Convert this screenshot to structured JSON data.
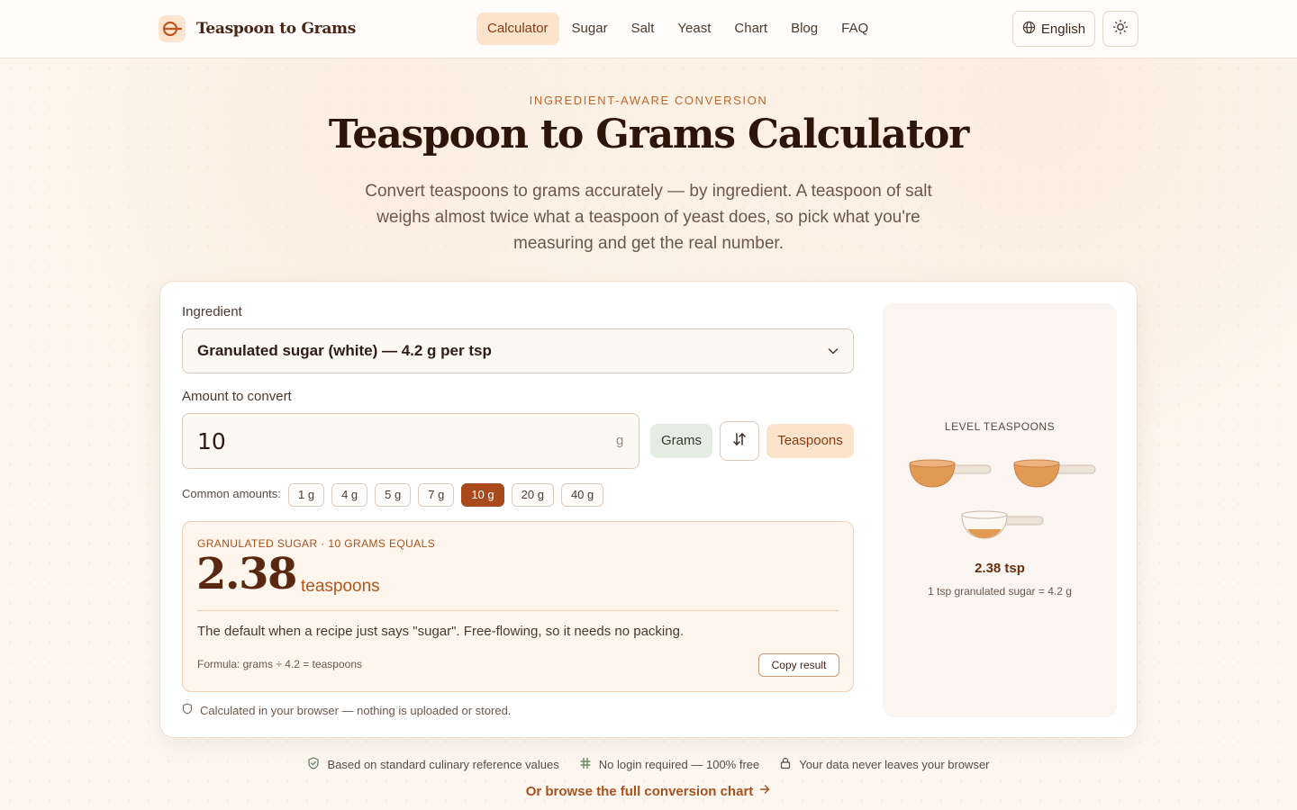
{
  "app": {
    "logo_text": "Teaspoon to Grams",
    "accent": "#a84a1c",
    "brand_color": "#4a2414"
  },
  "nav": {
    "items": [
      {
        "label": "Calculator",
        "active": true
      },
      {
        "label": "Sugar"
      },
      {
        "label": "Salt"
      },
      {
        "label": "Yeast"
      },
      {
        "label": "Chart"
      },
      {
        "label": "Blog"
      },
      {
        "label": "FAQ"
      }
    ],
    "language_label": "English",
    "language_icon": "globe-icon",
    "theme_icon": "sun-icon"
  },
  "hero": {
    "eyebrow": "INGREDIENT-AWARE CONVERSION",
    "title": "Teaspoon to Grams Calculator",
    "subtitle": "Convert teaspoons to grams accurately — by ingredient. A teaspoon of salt weighs almost twice what a teaspoon of yeast does, so pick what you're measuring and get the real number."
  },
  "calculator": {
    "ingredient_label": "Ingredient",
    "ingredient_value": "Granulated sugar (white) — 4.2 g per tsp",
    "amount_label": "Amount to convert",
    "amount_value": "10",
    "amount_unit": "g",
    "from_unit": "Grams",
    "to_unit": "Teaspoons",
    "common_label": "Common amounts:",
    "common_amounts": [
      "1 g",
      "4 g",
      "5 g",
      "7 g",
      "10 g",
      "20 g",
      "40 g"
    ],
    "selected_amount": "10 g",
    "privacy_note": "Calculated in your browser — nothing is uploaded or stored."
  },
  "result": {
    "eyebrow": "GRANULATED SUGAR · 10 GRAMS EQUALS",
    "value": "2.38",
    "unit": "teaspoons",
    "note": "The default when a recipe just says \"sugar\". Free-flowing, so it needs no packing.",
    "formula": "Formula: grams ÷ 4.2 = teaspoons",
    "copy_label": "Copy result"
  },
  "visual": {
    "title": "LEVEL TEASPOONS",
    "spoon_fills": [
      1,
      1,
      0.38
    ],
    "value_label": "2.38 tsp",
    "caption": "1 tsp granulated sugar = 4.2 g"
  },
  "footer": {
    "trust": [
      {
        "icon": "shield-check-icon",
        "label": "Based on standard culinary reference values"
      },
      {
        "icon": "hash-icon",
        "label": "No login required — 100% free"
      },
      {
        "icon": "lock-icon",
        "label": "Your data never leaves your browser"
      }
    ],
    "chart_link": "Or browse the full conversion chart",
    "chart_link_icon": "arrow-right-icon"
  }
}
